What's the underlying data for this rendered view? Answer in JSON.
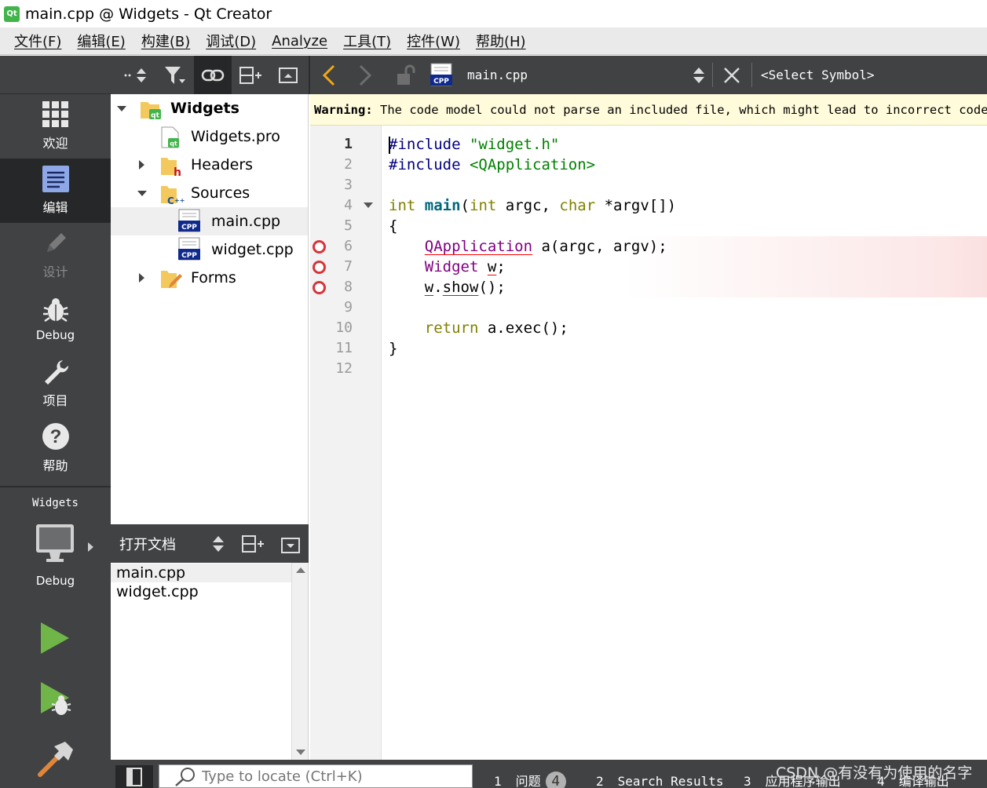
{
  "window": {
    "title": "main.cpp @ Widgets - Qt Creator",
    "logo_text": "Qt"
  },
  "menubar": {
    "items": [
      "文件(F)",
      "编辑(E)",
      "构建(B)",
      "调试(D)",
      "Analyze",
      "工具(T)",
      "控件(W)",
      "帮助(H)"
    ]
  },
  "modes": {
    "welcome": "欢迎",
    "edit": "编辑",
    "design": "设计",
    "debug": "Debug",
    "projects": "项目",
    "help": "帮助"
  },
  "kit": {
    "project": "Widgets",
    "config": "Debug"
  },
  "project_tree": {
    "root": "Widgets",
    "pro_file": "Widgets.pro",
    "headers": "Headers",
    "sources": "Sources",
    "source_files": [
      "main.cpp",
      "widget.cpp"
    ],
    "forms": "Forms",
    "cpp_badge": "CPP"
  },
  "open_documents": {
    "title": "打开文档",
    "items": [
      "main.cpp",
      "widget.cpp"
    ]
  },
  "editor_toolbar": {
    "file_name": "main.cpp",
    "symbol": "<Select Symbol>"
  },
  "warning": {
    "label": "Warning:",
    "text": " The code model could not parse an included file, which might lead to incorrect code co"
  },
  "code": {
    "line_numbers": [
      "1",
      "2",
      "3",
      "4",
      "5",
      "6",
      "7",
      "8",
      "9",
      "10",
      "11",
      "12"
    ],
    "l1_directive": "#include",
    "l1_string": " \"widget.h\"",
    "l2_directive": "#include",
    "l2_string": " <QApplication>",
    "l4_int": "int",
    "l4_main": "main",
    "l4_paren": "(",
    "l4_int2": "int",
    "l4_argc": " argc, ",
    "l4_char": "char",
    "l4_rest": " *argv[])",
    "l5": "{",
    "l6_indent": "    ",
    "l6_type": "QApplication",
    "l6_rest": " a(argc, argv);",
    "l7_indent": "    ",
    "l7_type": "Widget",
    "l7_space": " ",
    "l7_var": "w",
    "l7_semi": ";",
    "l8_indent": "    ",
    "l8_w": "w",
    "l8_dot": ".",
    "l8_show": "show",
    "l8_rest": "();",
    "l10_indent": "    ",
    "l10_return": "return",
    "l10_rest": " a.exec();",
    "l11": "}"
  },
  "statusbar": {
    "locator_placeholder": "Type to locate (Ctrl+K)",
    "tabs": [
      {
        "num": "1",
        "label": "问题"
      },
      {
        "num": "2",
        "label": "Search Results"
      },
      {
        "num": "3",
        "label": "应用程序输出"
      },
      {
        "num": "4",
        "label": "编译输出"
      }
    ],
    "issues_count": "4",
    "watermark": "CSDN @有没有为使用的名字"
  },
  "colors": {
    "sidebar_bg": "#404244",
    "sidebar_active": "#262728",
    "warning_bg": "#fffbdb",
    "run_green": "#6fb548",
    "breakpoint_red": "#d9323a"
  }
}
